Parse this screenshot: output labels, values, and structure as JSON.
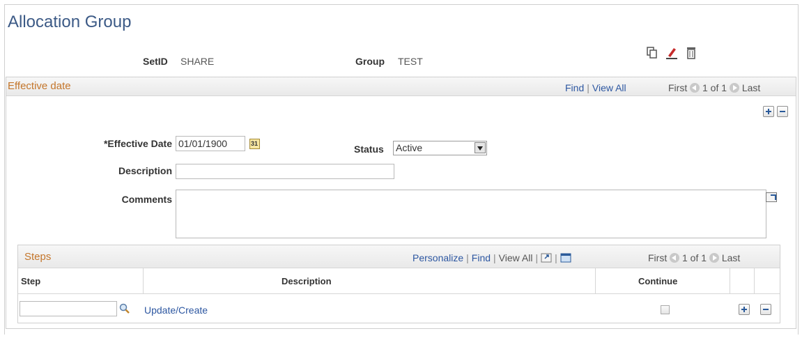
{
  "page": {
    "title": "Allocation Group"
  },
  "header": {
    "setid_label": "SetID",
    "setid_value": "SHARE",
    "group_label": "Group",
    "group_value": "TEST",
    "icons": [
      "copy-icon",
      "edit-icon",
      "delete-icon"
    ]
  },
  "effective_date_section": {
    "title": "Effective date",
    "find": "Find",
    "view_all": "View All",
    "first": "First",
    "counter": "1 of 1",
    "last": "Last"
  },
  "form": {
    "effective_date_label": "*Effective Date",
    "effective_date_value": "01/01/1900",
    "status_label": "Status",
    "status_value": "Active",
    "description_label": "Description",
    "description_value": "",
    "comments_label": "Comments",
    "comments_value": ""
  },
  "steps_grid": {
    "title": "Steps",
    "personalize": "Personalize",
    "find": "Find",
    "view_all": "View All",
    "first": "First",
    "counter": "1 of 1",
    "last": "Last",
    "columns": [
      "Step",
      "Description",
      "Continue"
    ],
    "rows": [
      {
        "step": "",
        "description": "Update/Create",
        "continue": false
      }
    ]
  }
}
